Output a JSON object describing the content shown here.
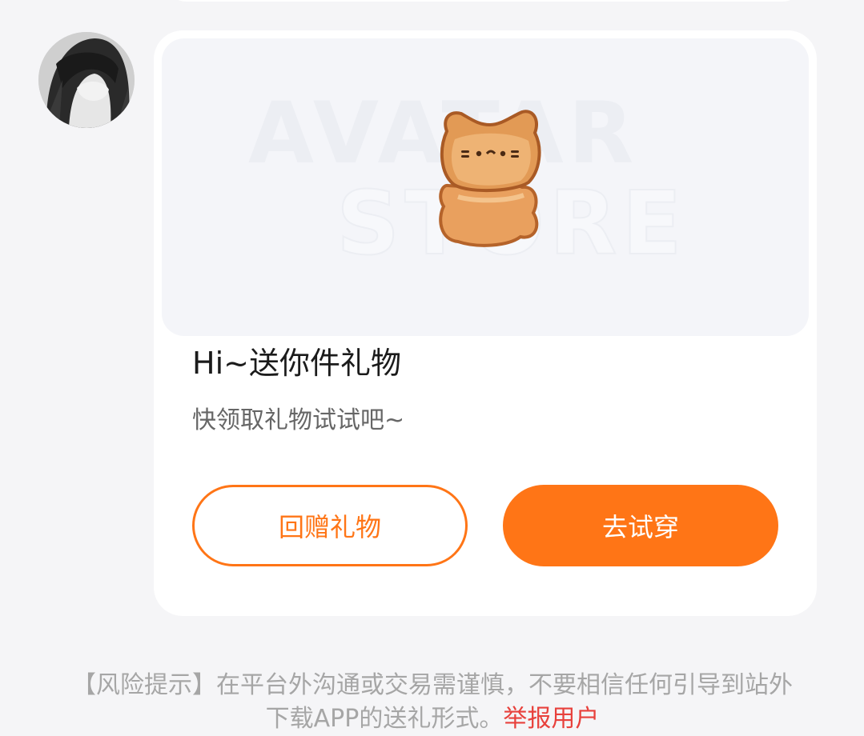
{
  "card": {
    "watermark_line1": "AVATAR",
    "watermark_line2": "STORE",
    "gift_icon": "cat-bread-gift-icon",
    "title": "Hi~送你件礼物",
    "subtitle": "快领取礼物试试吧~",
    "return_gift_label": "回赠礼物",
    "try_on_label": "去试穿"
  },
  "footer": {
    "risk_text": "【风险提示】在平台外沟通或交易需谨慎，不要相信任何引导到站外下载APP的送礼形式。",
    "report_label": "举报用户"
  },
  "colors": {
    "accent": "#ff7516",
    "report": "#e8413c",
    "background": "#f5f5f7"
  }
}
